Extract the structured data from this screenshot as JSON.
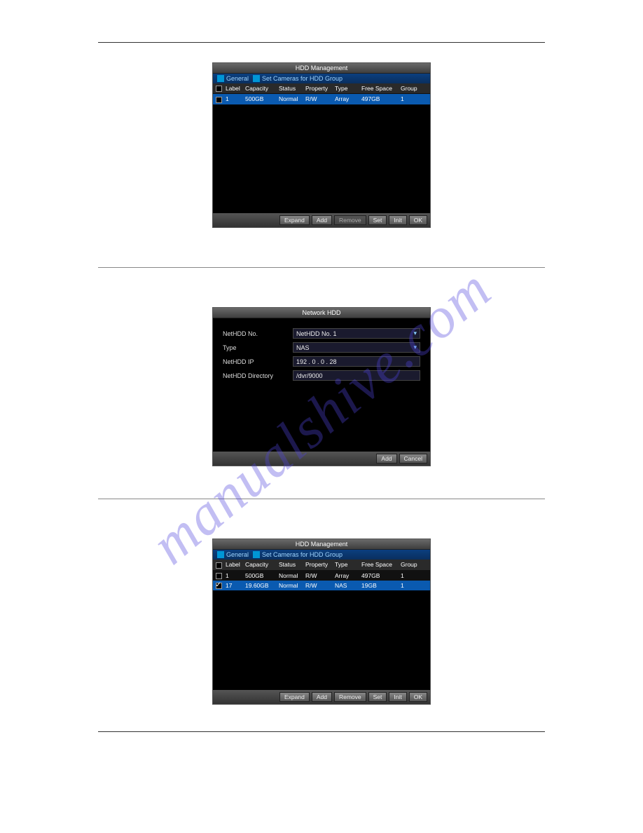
{
  "watermark": "manualshive.com",
  "hdd1": {
    "title": "HDD Management",
    "tabs": {
      "general": "General",
      "setcams": "Set Cameras for HDD Group"
    },
    "headers": {
      "label": "Label",
      "capacity": "Capacity",
      "status": "Status",
      "property": "Property",
      "type": "Type",
      "freespace": "Free Space",
      "group": "Group"
    },
    "rows": [
      {
        "checked": false,
        "label": "1",
        "capacity": "500GB",
        "status": "Normal",
        "property": "R/W",
        "type": "Array",
        "freespace": "497GB",
        "group": "1",
        "highlight": true
      }
    ],
    "buttons": {
      "expand": "Expand",
      "add": "Add",
      "remove": "Remove",
      "set": "Set",
      "init": "Init",
      "ok": "OK"
    }
  },
  "nethdd": {
    "title": "Network HDD",
    "fields": {
      "no_label": "NetHDD No.",
      "no_value": "NetHDD No. 1",
      "type_label": "Type",
      "type_value": "NAS",
      "ip_label": "NetHDD IP",
      "ip_value": "192 . 0    . 0    . 28",
      "dir_label": "NetHDD Directory",
      "dir_value": "/dvr/9000"
    },
    "buttons": {
      "add": "Add",
      "cancel": "Cancel"
    }
  },
  "hdd2": {
    "title": "HDD Management",
    "tabs": {
      "general": "General",
      "setcams": "Set Cameras for HDD Group"
    },
    "headers": {
      "label": "Label",
      "capacity": "Capacity",
      "status": "Status",
      "property": "Property",
      "type": "Type",
      "freespace": "Free Space",
      "group": "Group"
    },
    "rows": [
      {
        "checked": false,
        "label": "1",
        "capacity": "500GB",
        "status": "Normal",
        "property": "R/W",
        "type": "Array",
        "freespace": "497GB",
        "group": "1",
        "highlight": false
      },
      {
        "checked": true,
        "label": "17",
        "capacity": "19.60GB",
        "status": "Normal",
        "property": "R/W",
        "type": "NAS",
        "freespace": "19GB",
        "group": "1",
        "highlight": true
      }
    ],
    "buttons": {
      "expand": "Expand",
      "add": "Add",
      "remove": "Remove",
      "set": "Set",
      "init": "Init",
      "ok": "OK"
    }
  }
}
